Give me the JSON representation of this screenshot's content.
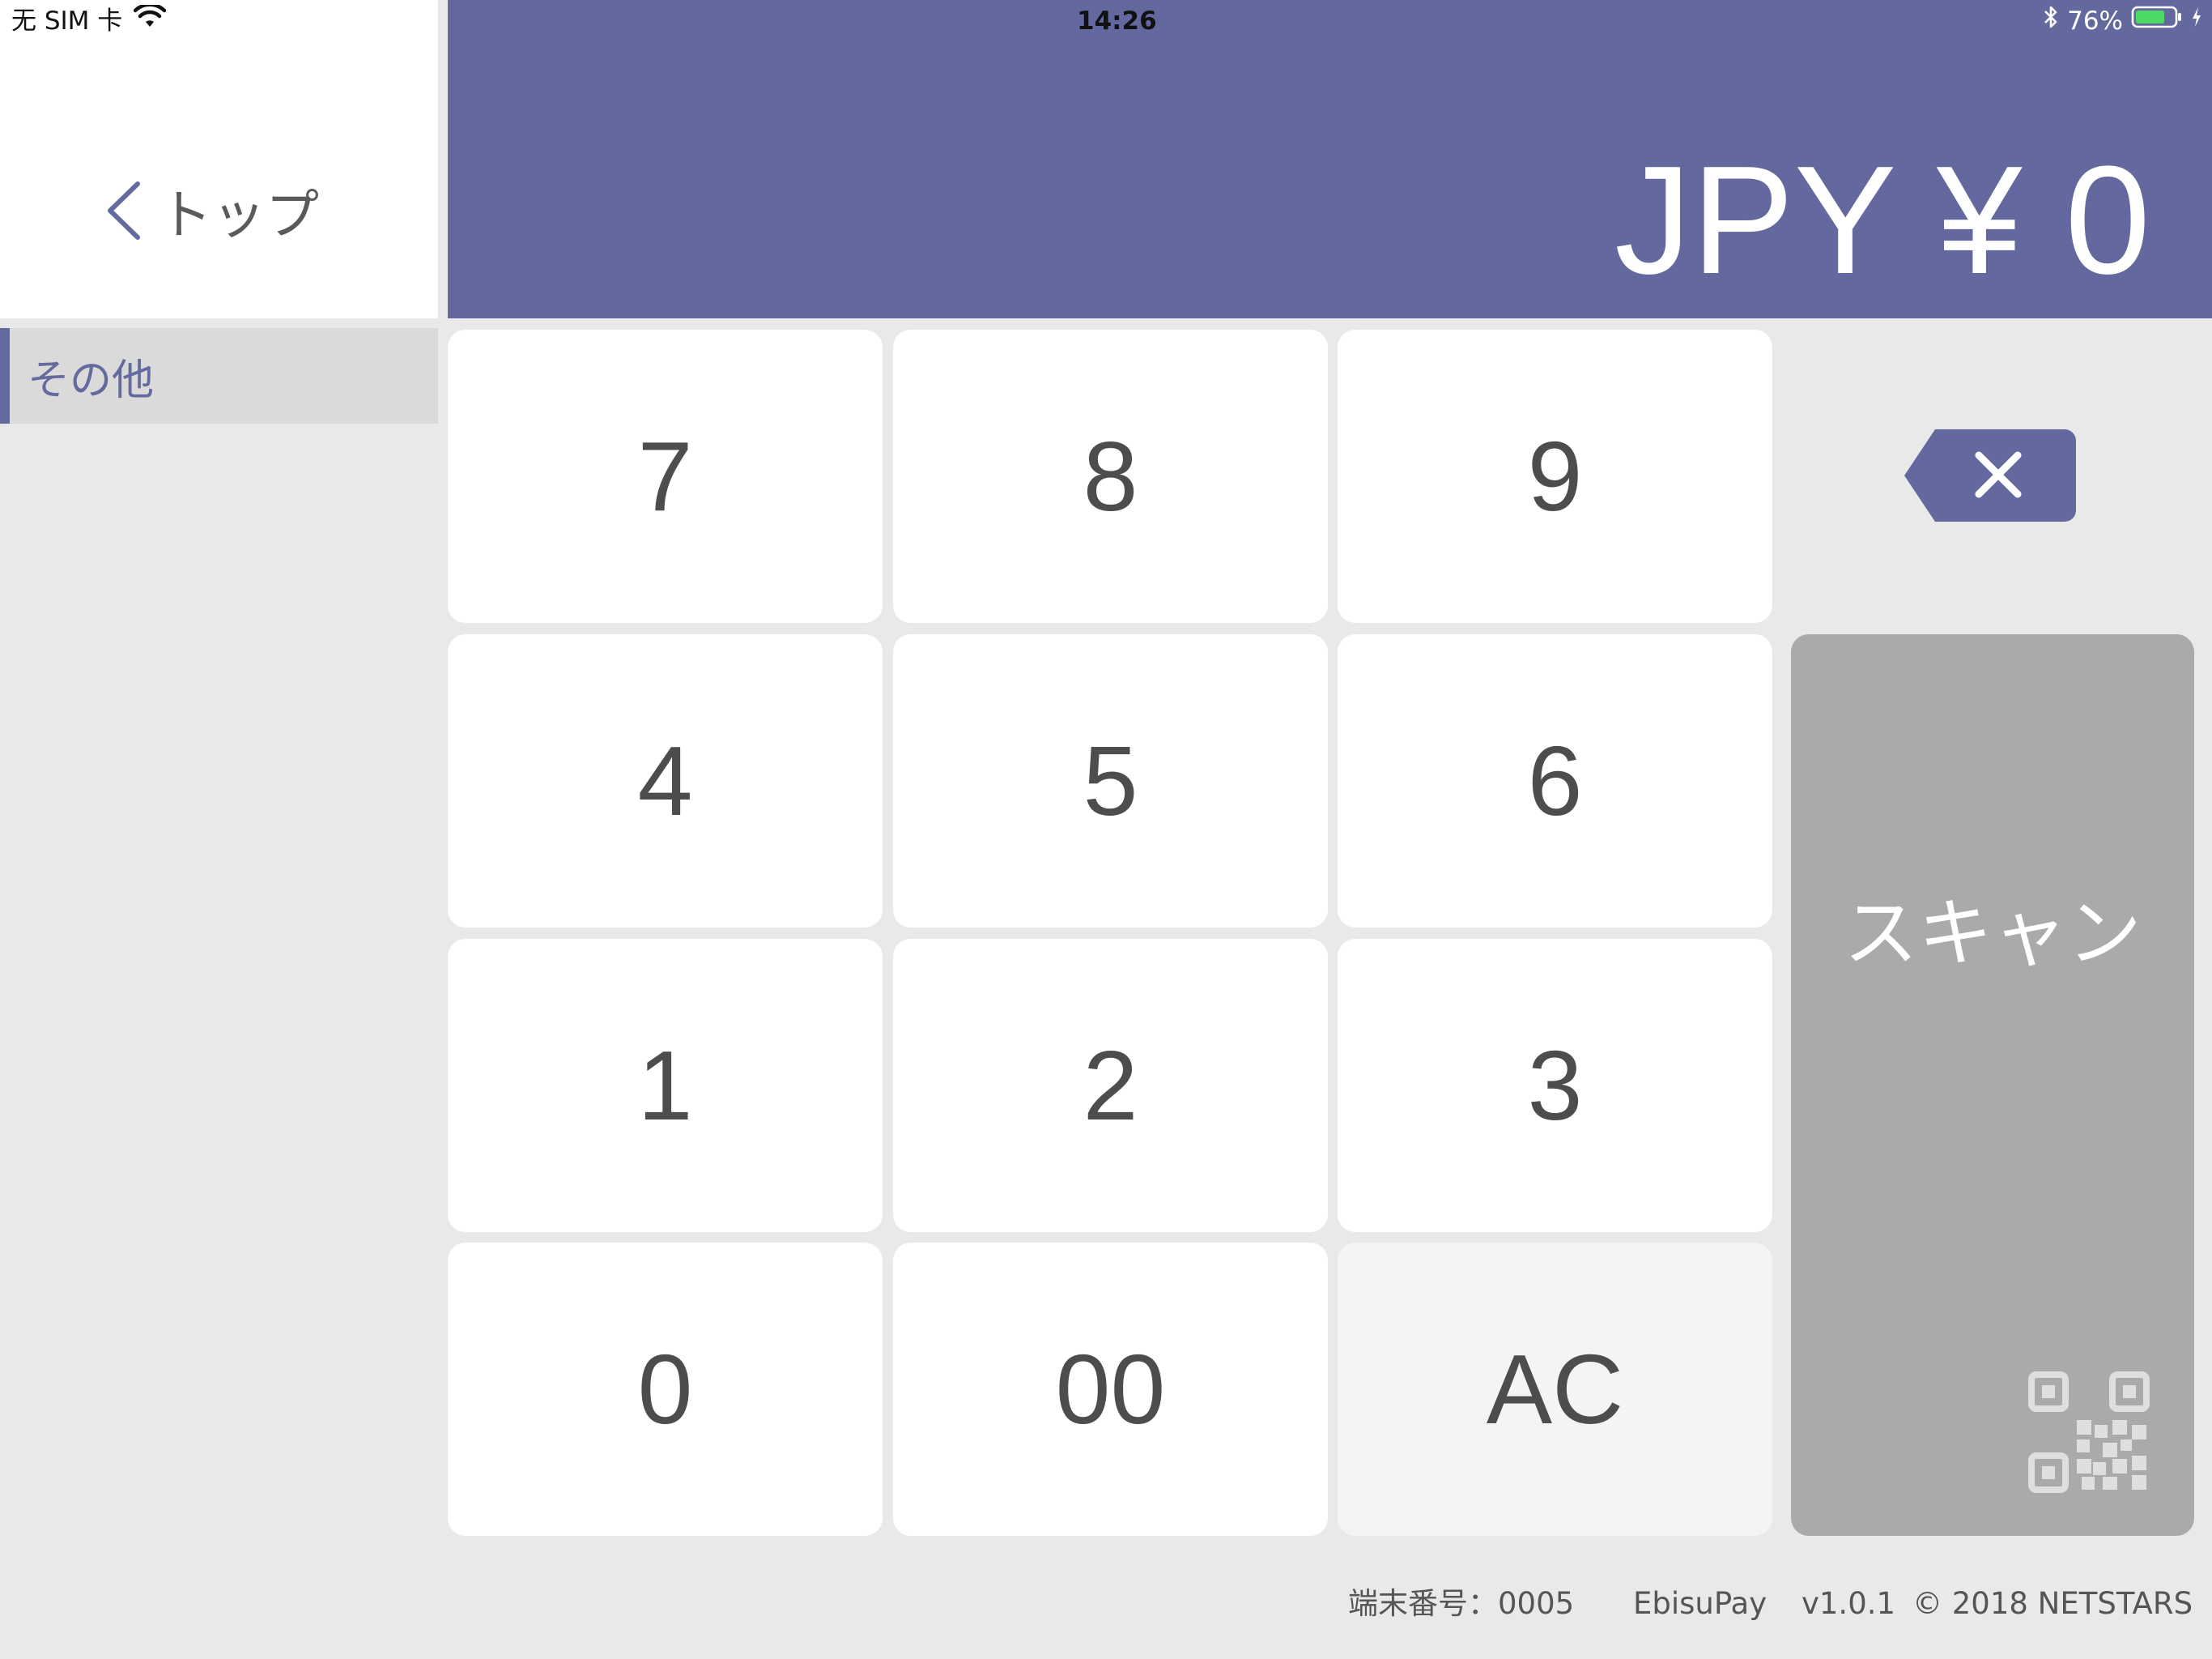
{
  "status_bar": {
    "carrier": "无 SIM 卡",
    "time": "14:26",
    "battery": "76%"
  },
  "sidebar": {
    "back_label": "トップ",
    "items": [
      {
        "label": "その他",
        "selected": true
      }
    ]
  },
  "amount": {
    "display": "JPY ¥ 0"
  },
  "keypad": {
    "keys": [
      "7",
      "8",
      "9",
      "4",
      "5",
      "6",
      "1",
      "2",
      "3",
      "0",
      "00",
      "AC"
    ]
  },
  "scan": {
    "label": "スキャン",
    "icon": "qr-code-icon"
  },
  "footer": {
    "terminal": "端末番号：0005",
    "app_name": "EbisuPay",
    "version": "v1.0.1",
    "copyright": "© 2018 NETSTARS"
  },
  "colors": {
    "accent": "#63699f",
    "background": "#e9e9e9",
    "key": "#ffffff",
    "scan_button": "#aaaaaa",
    "battery": "#4cd964"
  }
}
